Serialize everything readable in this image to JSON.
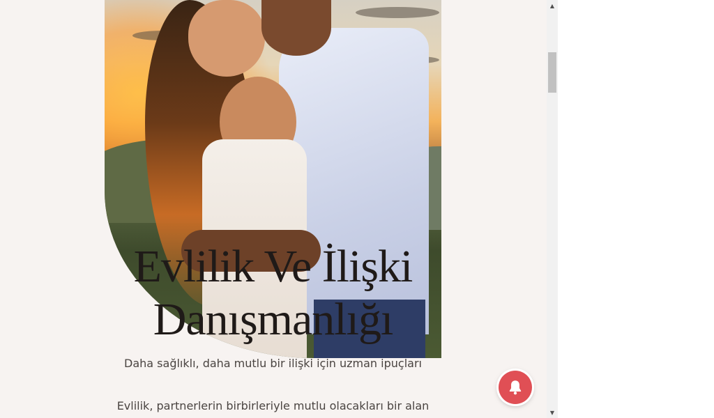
{
  "hero": {
    "title_line1": "Evlilik Ve İlişki",
    "title_line2": "Danışmanlığı",
    "subtitle": "Daha sağlıklı, daha mutlu bir ilişki için uzman ipuçları",
    "photo_icon": "couple-photo"
  },
  "intro": {
    "text": "Evlilik, partnerlerin birbirleriyle mutlu olacakları bir alan"
  },
  "notification": {
    "icon": "bell-icon",
    "color": "#e04f55"
  },
  "scrollbar": {
    "up_arrow": "▲",
    "down_arrow": "▼"
  },
  "colors": {
    "page_background": "#f7f3f1",
    "title": "#1f1a18",
    "body_text": "#4a4441"
  }
}
